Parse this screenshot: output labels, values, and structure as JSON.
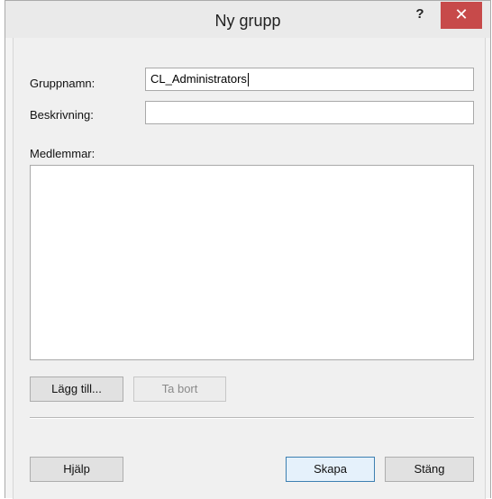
{
  "window": {
    "title": "Ny grupp",
    "help_label": "?",
    "close_label": "✕"
  },
  "form": {
    "group_name_label": "Gruppnamn:",
    "group_name_value": "CL_Administrators",
    "description_label": "Beskrivning:",
    "description_value": "",
    "members_label": "Medlemmar:",
    "members": []
  },
  "buttons": {
    "add": "Lägg till...",
    "remove": "Ta bort",
    "help": "Hjälp",
    "create": "Skapa",
    "close": "Stäng"
  }
}
